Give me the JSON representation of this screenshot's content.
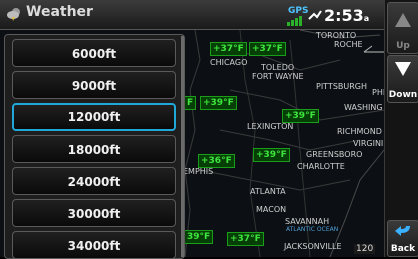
{
  "header": {
    "title": "Weather",
    "gps_label": "GPS",
    "time": "2:53",
    "time_suffix": "a"
  },
  "altitude_options": [
    "6000ft",
    "9000ft",
    "12000ft",
    "18000ft",
    "24000ft",
    "30000ft",
    "34000ft"
  ],
  "selected_option": "12000ft",
  "sidebar": {
    "up_label": "Up",
    "down_label": "Down",
    "back_label": "Back"
  },
  "map": {
    "cities": [
      "TORONTO",
      "ROCHE",
      "CHICAGO",
      "TOLEDO",
      "FORT WAYNE",
      "PITTSBURGH",
      "PHI",
      "WASHING",
      "LEXINGTON",
      "RICHMOND",
      "VIRGINI",
      "GREENSBORO",
      "CHARLOTTE",
      "EMPHIS",
      "ATLANTA",
      "MACON",
      "SAVANNAH",
      "ATLANTIC OCEAN",
      "JACKSONVILLE"
    ],
    "temperatures": [
      "+37°F",
      "+37°F",
      "F",
      "+39°F",
      "+39°F",
      "+36°F",
      "+39°F",
      "39°F",
      "+37°F"
    ],
    "scale_label": "120"
  },
  "colors": {
    "accent": "#1fa8d8",
    "temp_text": "#3de53d",
    "temp_bg": "#063f06"
  }
}
